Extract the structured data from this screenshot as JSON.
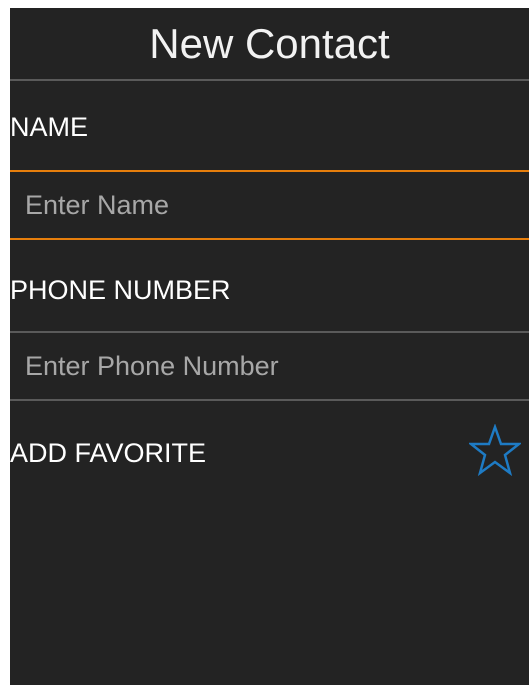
{
  "header": {
    "title": "New Contact"
  },
  "form": {
    "name_label": "NAME",
    "name_placeholder": "Enter Name",
    "name_value": "",
    "phone_label": "PHONE NUMBER",
    "phone_placeholder": "Enter Phone Number",
    "phone_value": "",
    "favorite_label": "ADD FAVORITE",
    "favorite_icon": "star-outline-icon"
  },
  "colors": {
    "background": "#232323",
    "focus_accent": "#e67e0c",
    "divider": "#5a5a5a",
    "star": "#1e7bc4"
  }
}
